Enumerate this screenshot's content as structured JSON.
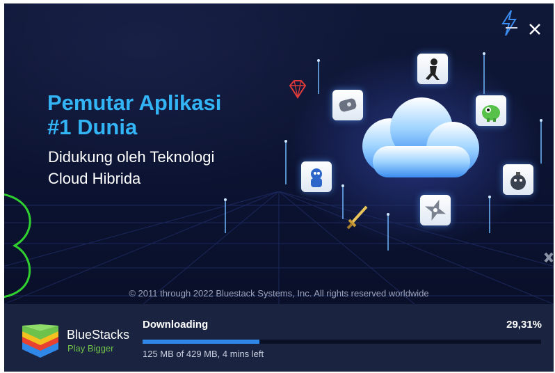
{
  "window": {
    "heading": "Pemutar Aplikasi\n#1 Dunia",
    "subheading": "Didukung oleh Teknologi\nCloud Hibrida",
    "copyright": "© 2011 through 2022 Bluestack Systems, Inc. All rights reserved worldwide",
    "close_icon": "close-icon",
    "boost_icon": "lightning-icon"
  },
  "footer": {
    "brand": "BlueStacks",
    "tagline": "Play Bigger",
    "status": "Downloading",
    "percent_text": "29,31%",
    "progress_fraction": 0.2931,
    "detail": "125 MB of 429 MB, 4 mins left"
  },
  "colors": {
    "background": "#0d1433",
    "heading": "#33b4f5",
    "progress": "#2f88e8",
    "footer_bg": "#1a2440",
    "tagline": "#71c14a"
  },
  "app_icons": [
    "gem-icon",
    "gamepad-icon",
    "ninja-icon",
    "dino-icon",
    "spaceman-icon",
    "bomb-icon",
    "shuriken-icon",
    "sword-icon",
    "cloud-icon"
  ]
}
